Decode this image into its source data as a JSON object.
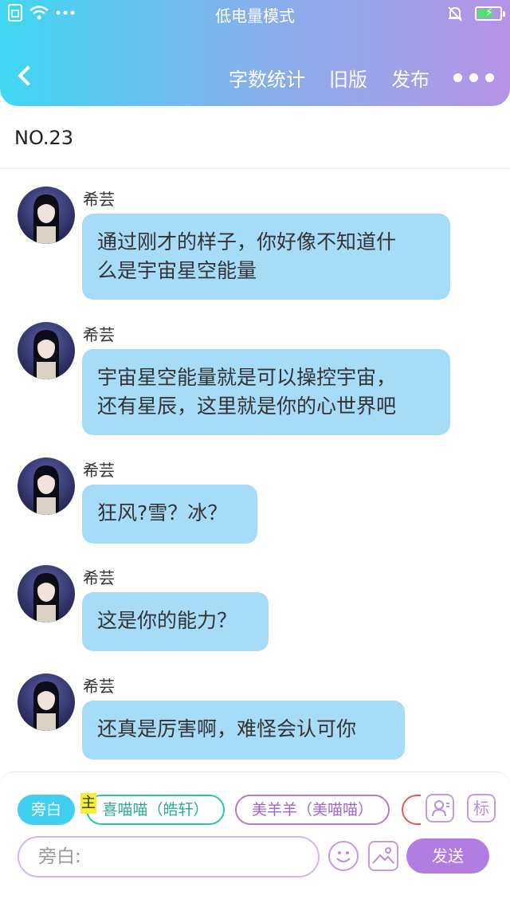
{
  "status_bar": {
    "title": "低电量模式"
  },
  "nav": {
    "word_count": "字数统计",
    "old_version": "旧版",
    "publish": "发布"
  },
  "page": {
    "title": "NO.23"
  },
  "messages": [
    {
      "sender": "希芸",
      "lines": [
        "通过刚才的样子，你好像不知道什",
        "么是宇宙星空能量"
      ]
    },
    {
      "sender": "希芸",
      "lines": [
        "宇宙星空能量就是可以操控宇宙，",
        "还有星辰，这里就是你的心世界吧"
      ]
    },
    {
      "sender": "希芸",
      "lines": [
        "狂风?雪？冰？"
      ]
    },
    {
      "sender": "希芸",
      "lines": [
        "这是你的能力？"
      ]
    },
    {
      "sender": "希芸",
      "lines": [
        "还真是厉害啊，难怪会认可你"
      ]
    }
  ],
  "composer": {
    "narrator": "旁白",
    "main_tag": "主",
    "role_1": "喜喵喵（皓轩）",
    "role_2": "美羊羊（美喵喵）",
    "mark_button": "标",
    "input_placeholder": "旁白:",
    "send": "发送"
  },
  "colors": {
    "header_gradient_start": "#3fd7f2",
    "header_gradient_end": "#b593e6",
    "bubble": "#a7dcf8",
    "narrator_chip": "#40cff0",
    "send_button": "#b27de0"
  },
  "icons": {
    "back": "chevron-left-icon",
    "more": "more-dots-icon",
    "emoji": "smiley-icon",
    "image": "image-icon",
    "role": "person-card-icon"
  }
}
